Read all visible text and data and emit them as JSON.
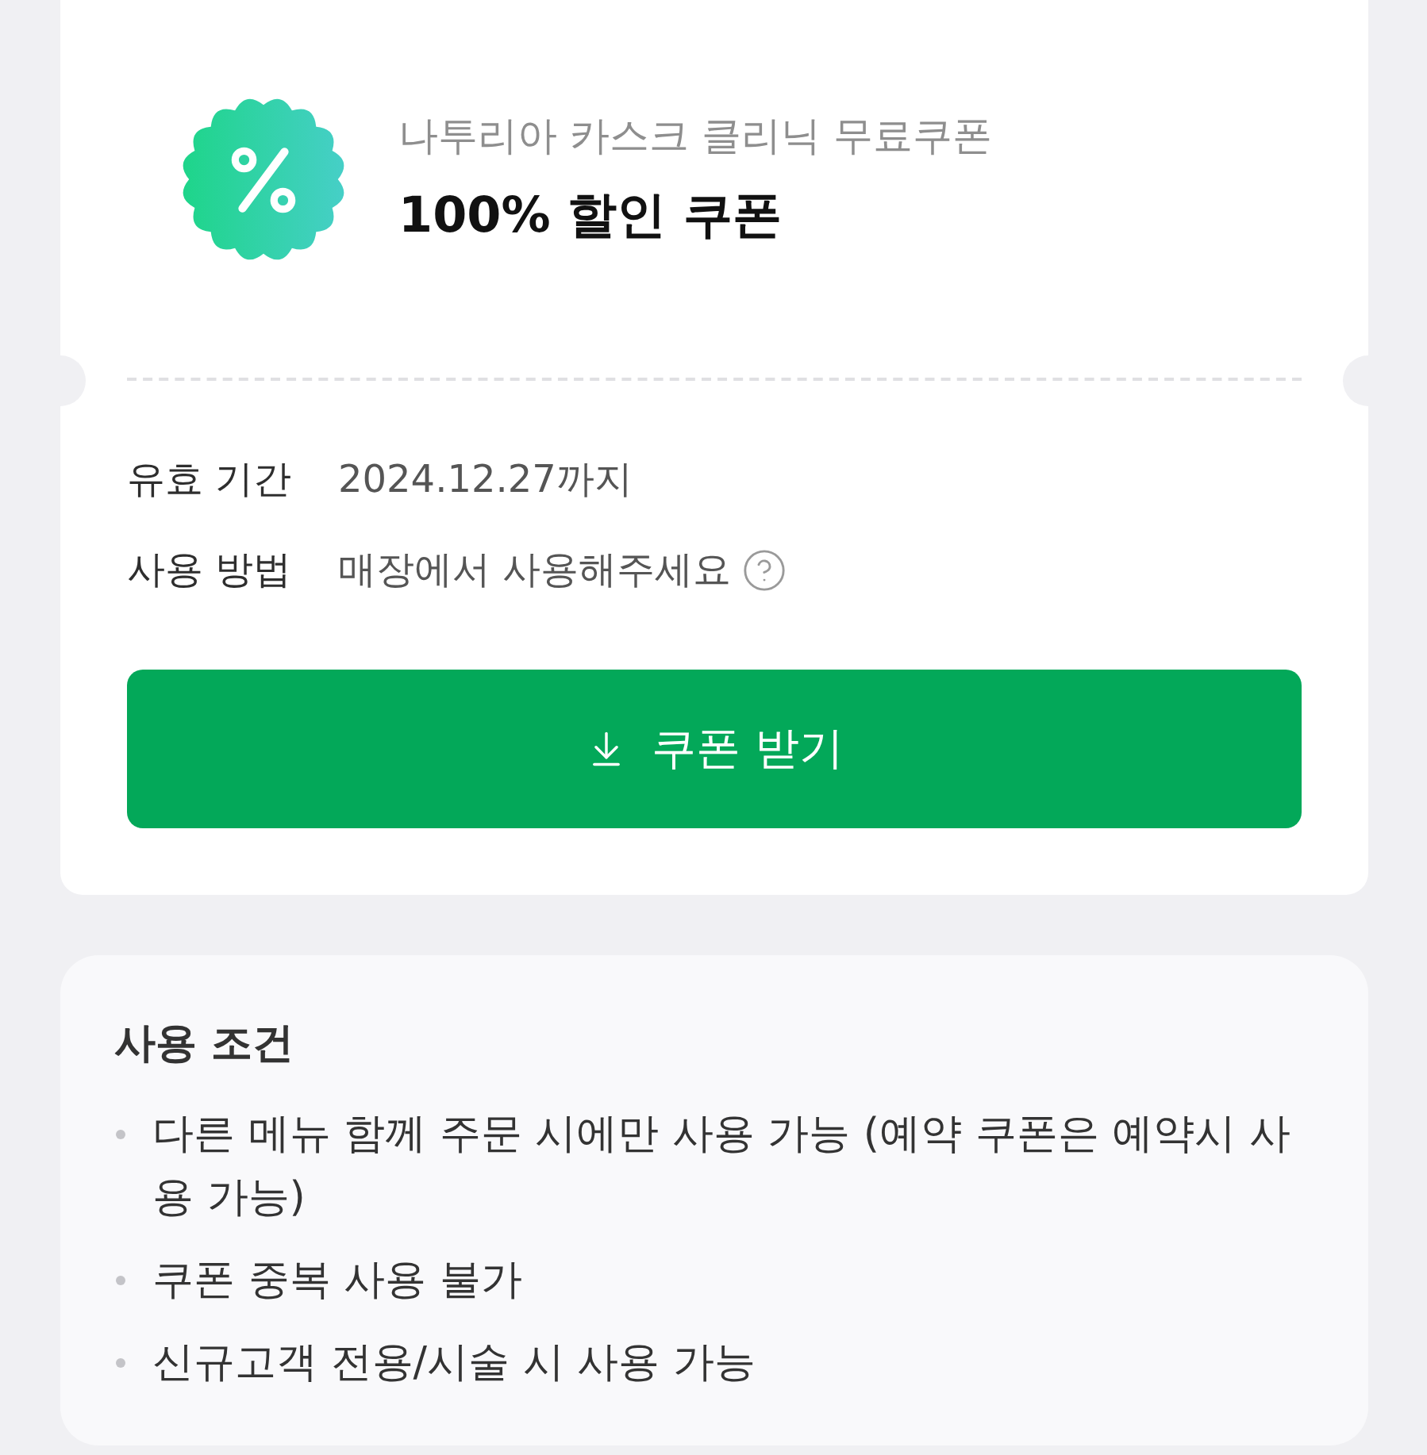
{
  "coupon": {
    "subtitle": "나투리아 카스크 클리닉 무료쿠폰",
    "title": "100% 할인 쿠폰"
  },
  "details": [
    {
      "label": "유효 기간",
      "value": "2024.12.27까지",
      "help": false
    },
    {
      "label": "사용 방법",
      "value": "매장에서 사용해주세요",
      "help": true
    }
  ],
  "download_button": {
    "label": "쿠폰 받기"
  },
  "conditions": {
    "title": "사용 조건",
    "items": [
      "다른 메뉴 함께 주문 시에만 사용 가능 (예약 쿠폰은 예약시 사용 가능)",
      "쿠폰 중복 사용 불가",
      "신규고객 전용/시술 시 사용 가능"
    ]
  }
}
